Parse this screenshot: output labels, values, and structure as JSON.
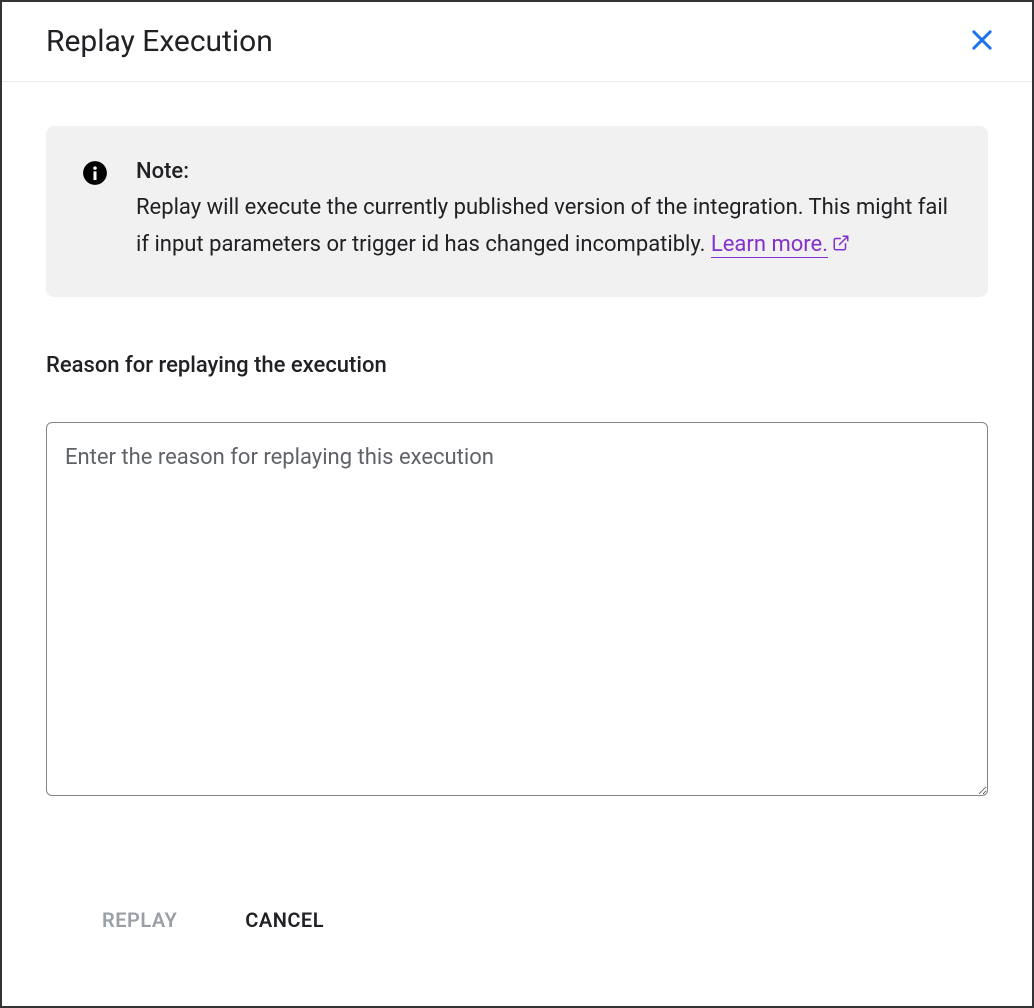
{
  "dialog": {
    "title": "Replay Execution"
  },
  "note": {
    "title": "Note:",
    "body": "Replay will execute the currently published version of the integration. This might fail if input parameters or trigger id has changed incompatibly. ",
    "learn_more": "Learn more."
  },
  "reason": {
    "label": "Reason for replaying the execution",
    "placeholder": "Enter the reason for replaying this execution",
    "value": ""
  },
  "footer": {
    "replay": "REPLAY",
    "cancel": "CANCEL"
  }
}
